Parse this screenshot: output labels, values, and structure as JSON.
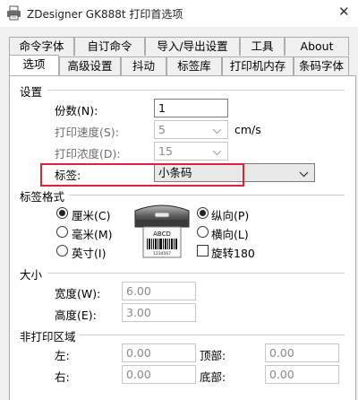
{
  "window": {
    "title": "ZDesigner GK888t 打印首选项",
    "close_glyph": "✕"
  },
  "tabs_row1": [
    {
      "label": "命令字体"
    },
    {
      "label": "自订命令"
    },
    {
      "label": "导入/导出设置"
    },
    {
      "label": "工具"
    },
    {
      "label": "About"
    }
  ],
  "tabs_row2": [
    {
      "label": "选项",
      "active": true
    },
    {
      "label": "高级设置"
    },
    {
      "label": "抖动"
    },
    {
      "label": "标签库"
    },
    {
      "label": "打印机内存"
    },
    {
      "label": "条码字体"
    }
  ],
  "settings": {
    "group_label": "设置",
    "copies_label": "份数(N):",
    "copies_value": "1",
    "speed_label": "打印速度(S):",
    "speed_value": "5",
    "speed_unit": "cm/s",
    "darkness_label": "打印浓度(D):",
    "darkness_value": "15",
    "stock_label": "标签:",
    "stock_value": "小条码"
  },
  "label_format": {
    "group_label": "标签格式",
    "units": [
      {
        "label": "厘米(C)",
        "checked": true
      },
      {
        "label": "毫米(M)",
        "checked": false
      },
      {
        "label": "英寸(I)",
        "checked": false
      }
    ],
    "printer_art": {
      "label_text": "ABCD",
      "barcode_text": "1234567"
    },
    "orientation": [
      {
        "label": "纵向(P)",
        "checked": true
      },
      {
        "label": "横向(L)",
        "checked": false
      }
    ],
    "rotate_label": "旋转180",
    "rotate_checked": false
  },
  "size": {
    "group_label": "大小",
    "width_label": "宽度(W):",
    "width_value": "6.00",
    "height_label": "高度(E):",
    "height_value": "3.00"
  },
  "unprintable": {
    "group_label": "非打印区域",
    "left_label": "左:",
    "left_value": "0.00",
    "top_label": "顶部:",
    "top_value": "0.00",
    "right_label": "右:",
    "right_value": "0.00",
    "bottom_label": "底部:",
    "bottom_value": "0.00"
  },
  "colors": {
    "highlight": "#d8282f",
    "tab_border": "#adadad",
    "dialog_bg": "#f0f0f0"
  }
}
